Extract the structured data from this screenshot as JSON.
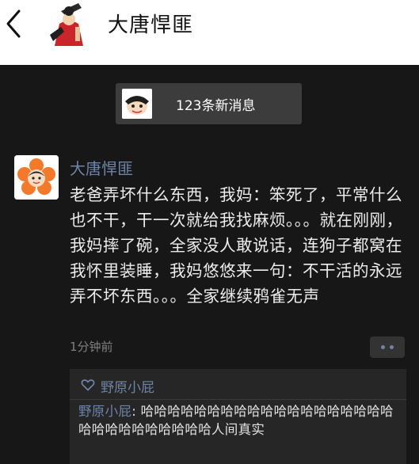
{
  "header": {
    "title": "大唐悍匪"
  },
  "new_messages": {
    "label": "123条新消息"
  },
  "post": {
    "author": "大唐悍匪",
    "text": "老爸弄坏什么东西，我妈：笨死了，平常什么也不干，干一次就给我找麻烦。。。就在刚刚，我妈摔了碗，全家没人敢说话，连狗子都窝在我怀里装睡，我妈悠悠来一句：不干活的永远弄不坏东西。。。全家继续鸦雀无声",
    "time": "1分钟前"
  },
  "likes": {
    "names": "野原小屁"
  },
  "comments": [
    {
      "author": "野原小屁",
      "separator": ": ",
      "text": "哈哈哈哈哈哈哈哈哈哈哈哈哈哈哈哈哈哈哈哈哈哈哈哈哈哈哈哈哈人间真实"
    }
  ],
  "colors": {
    "background": "#171717",
    "link_blue": "#6e84a8",
    "header_bg": "#ffffff",
    "comment_bg": "#262626"
  }
}
